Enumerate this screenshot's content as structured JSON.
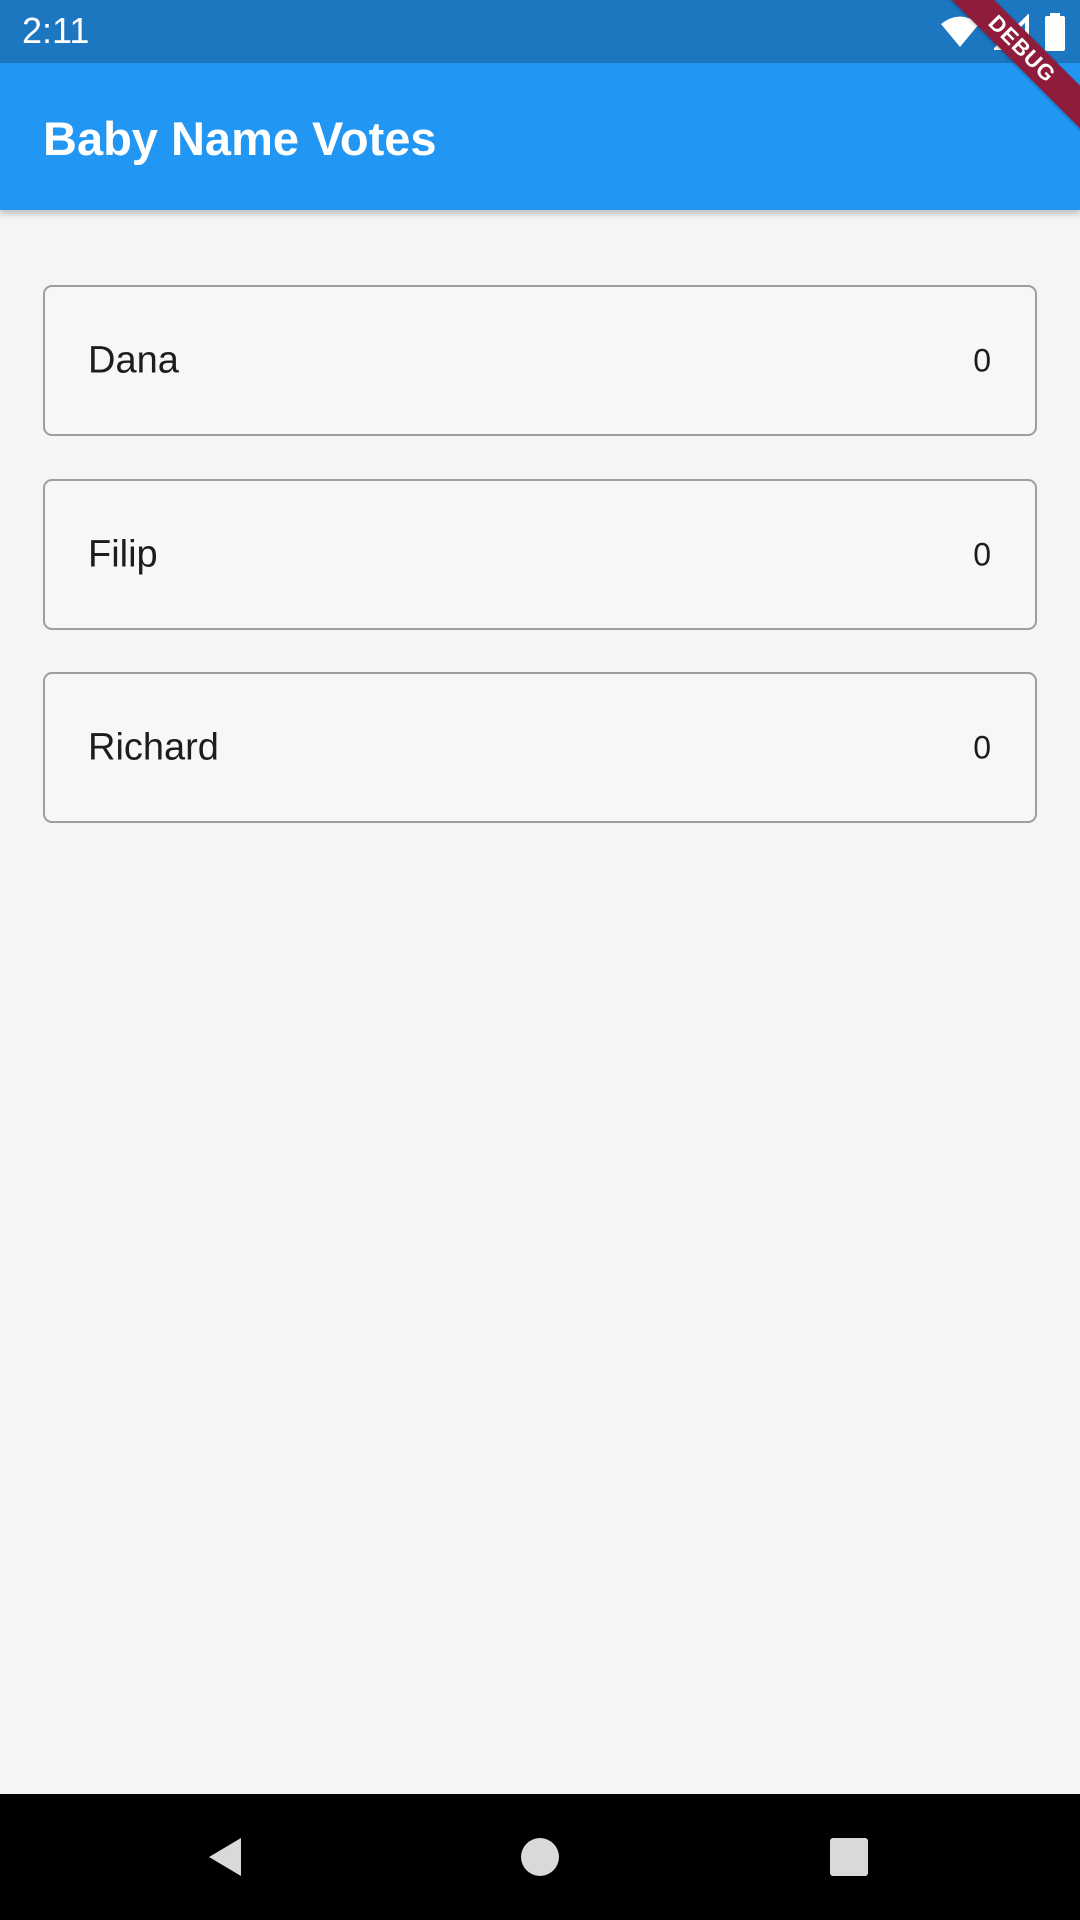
{
  "status_bar": {
    "time": "2:11",
    "icons": [
      "wifi-icon",
      "signal-icon",
      "battery-icon"
    ]
  },
  "app_bar": {
    "title": "Baby Name Votes",
    "color": "#2196f3"
  },
  "debug_banner": {
    "label": "DEBUG",
    "color": "#8f1c3a"
  },
  "votes": [
    {
      "name": "Dana",
      "count": "0"
    },
    {
      "name": "Filip",
      "count": "0"
    },
    {
      "name": "Richard",
      "count": "0"
    }
  ],
  "nav_bar": {
    "buttons": [
      "back-icon",
      "home-icon",
      "recents-icon"
    ]
  }
}
